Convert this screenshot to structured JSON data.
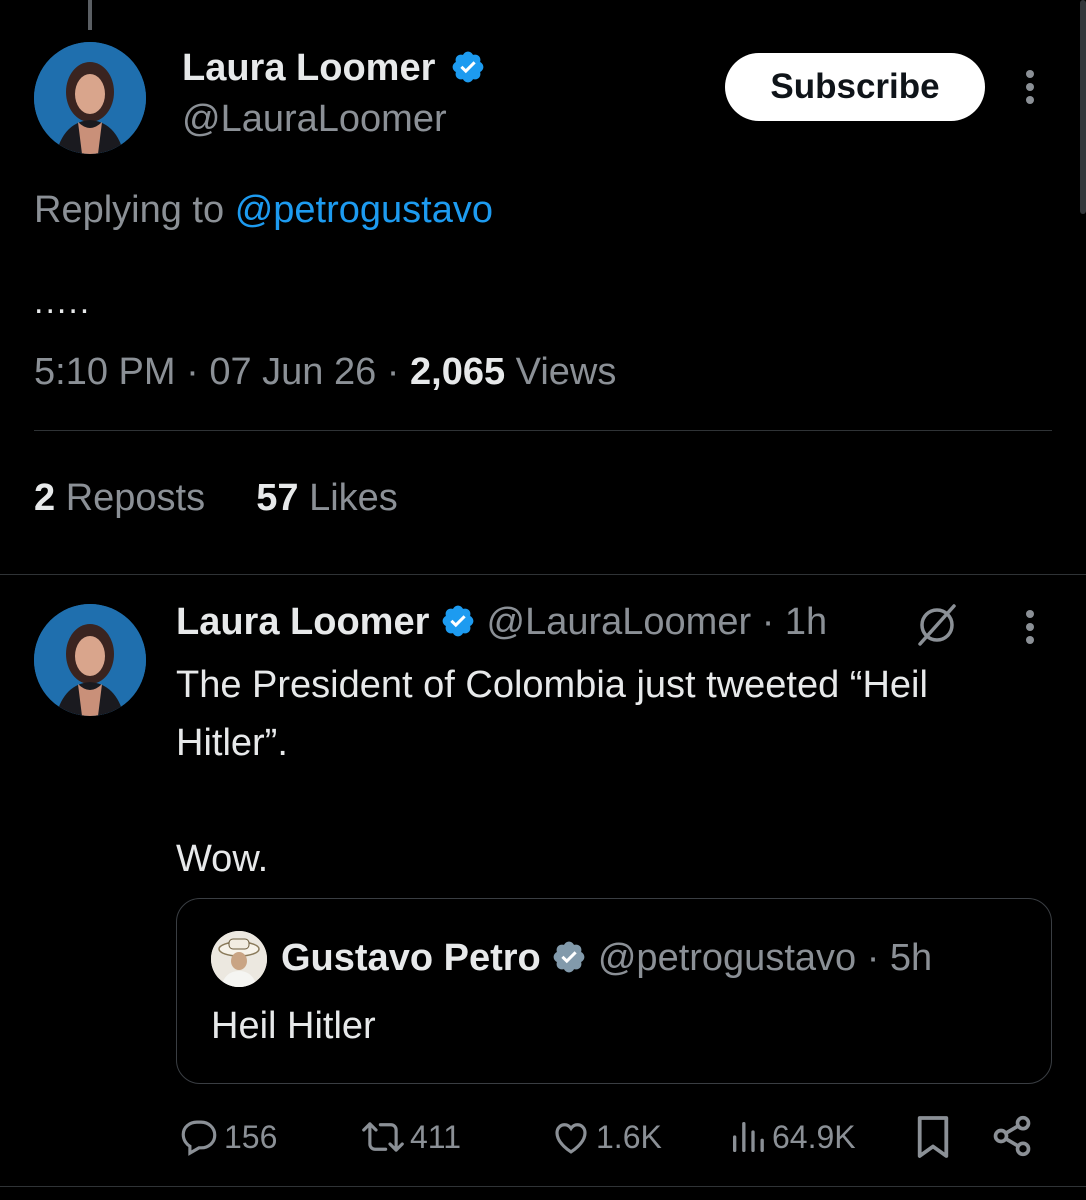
{
  "main_tweet": {
    "author_name": "Laura Loomer",
    "author_handle": "@LauraLoomer",
    "subscribe_label": "Subscribe",
    "replying_prefix": "Replying to",
    "replying_handle": "@petrogustavo",
    "body": ".....",
    "time": "5:10 PM",
    "date": "07 Jun 26",
    "views_count": "2,065",
    "views_label": "Views",
    "reposts_count": "2",
    "reposts_label": "Reposts",
    "likes_count": "57",
    "likes_label": "Likes"
  },
  "reply_tweet": {
    "author_name": "Laura Loomer",
    "author_handle": "@LauraLoomer",
    "time_ago": "· 1h",
    "text_line1": "The President of Colombia just tweeted “Heil",
    "text_line2": "Hitler”.",
    "text_line3": "Wow.",
    "quote": {
      "author_name": "Gustavo Petro",
      "author_handle": "@petrogustavo",
      "time_ago": "· 5h",
      "text": "Heil Hitler"
    },
    "actions": {
      "replies": "156",
      "reposts": "411",
      "likes": "1.6K",
      "views": "64.9K"
    }
  },
  "colors": {
    "background": "#000000",
    "text": "#e7e9ea",
    "muted": "#8b9096",
    "link_blue": "#1d9bf0",
    "verified_blue": "#1d9bf0"
  },
  "icons": [
    "verified-badge-icon",
    "more-options-icon",
    "grok-icon",
    "reply-icon",
    "repost-icon",
    "like-icon",
    "views-icon",
    "bookmark-icon",
    "share-icon"
  ]
}
